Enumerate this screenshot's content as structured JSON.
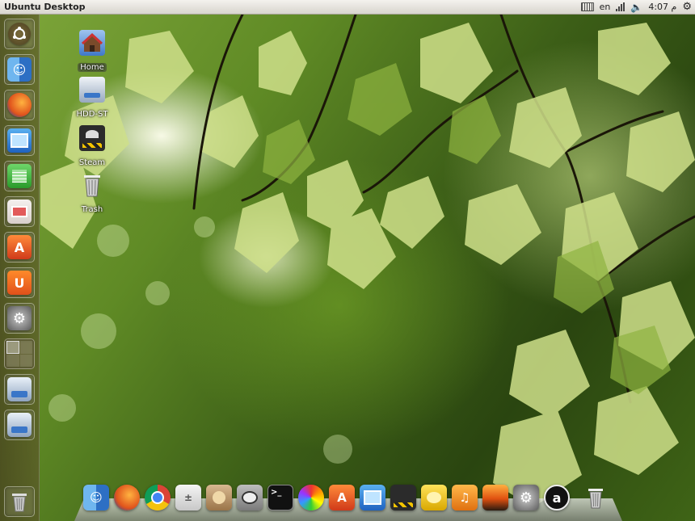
{
  "panel": {
    "title": "Ubuntu Desktop",
    "indicators": {
      "language": "en",
      "time": "4:07 م"
    }
  },
  "desktop_icons": [
    {
      "label": "Home",
      "icon": "home-folder-icon"
    },
    {
      "label": "HDD-ST",
      "icon": "hard-drive-icon"
    },
    {
      "label": "Steam",
      "icon": "steam-icon"
    },
    {
      "label": "Trash",
      "icon": "trash-icon"
    }
  ],
  "launcher": [
    {
      "name": "ubuntu-logo-icon"
    },
    {
      "name": "finder-icon"
    },
    {
      "name": "firefox-icon"
    },
    {
      "name": "image-viewer-icon"
    },
    {
      "name": "spreadsheet-icon"
    },
    {
      "name": "presentation-icon"
    },
    {
      "name": "app-store-icon"
    },
    {
      "name": "ubuntu-one-icon"
    },
    {
      "name": "system-settings-icon"
    },
    {
      "name": "workspace-switcher-icon"
    },
    {
      "name": "drive-icon"
    },
    {
      "name": "drive-icon"
    },
    {
      "name": "trash-icon"
    }
  ],
  "dock": [
    {
      "name": "finder-icon"
    },
    {
      "name": "firefox-icon"
    },
    {
      "name": "chrome-icon"
    },
    {
      "name": "calculator-icon"
    },
    {
      "name": "archive-icon"
    },
    {
      "name": "gimp-icon"
    },
    {
      "name": "terminal-icon"
    },
    {
      "name": "color-picker-icon"
    },
    {
      "name": "app-store-icon"
    },
    {
      "name": "image-viewer-icon"
    },
    {
      "name": "steam-icon"
    },
    {
      "name": "pidgin-icon"
    },
    {
      "name": "music-icon"
    },
    {
      "name": "photo-icon"
    },
    {
      "name": "settings-icon"
    },
    {
      "name": "amazon-icon"
    },
    {
      "name": "trash-icon"
    }
  ],
  "colors": {
    "panel_bg": "#e6e3dd",
    "launcher_bg": "#5a5028",
    "foliage": "#6f9a2a"
  }
}
